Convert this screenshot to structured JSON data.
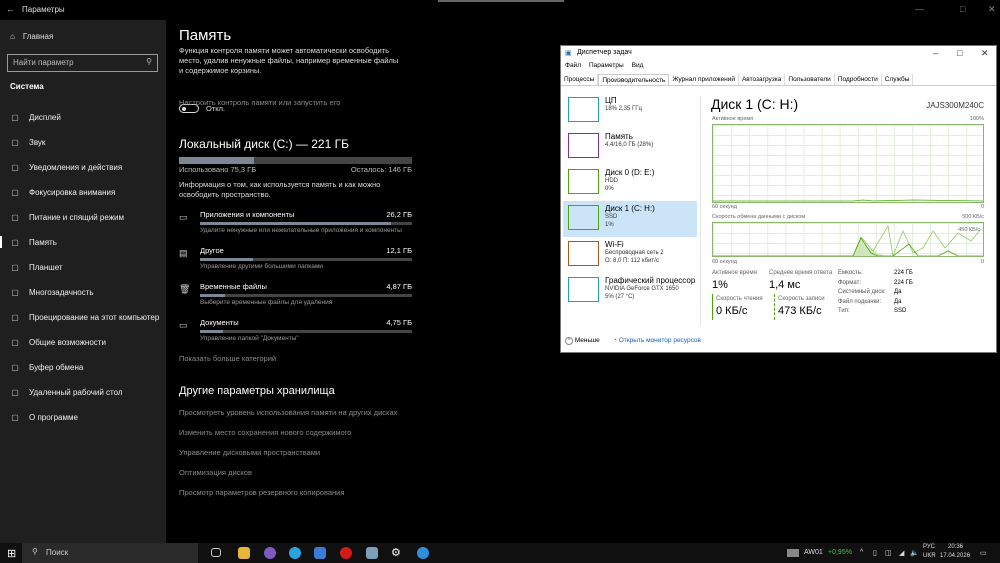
{
  "settings": {
    "title": "Параметры",
    "home": "Главная",
    "search_placeholder": "Найти параметр",
    "section": "Система",
    "nav": [
      {
        "label": "Дисплей",
        "icon": "monitor-icon"
      },
      {
        "label": "Звук",
        "icon": "speaker-icon"
      },
      {
        "label": "Уведомления и действия",
        "icon": "notification-icon"
      },
      {
        "label": "Фокусировка внимания",
        "icon": "moon-icon"
      },
      {
        "label": "Питание и спящий режим",
        "icon": "power-icon"
      },
      {
        "label": "Память",
        "icon": "storage-icon"
      },
      {
        "label": "Планшет",
        "icon": "tablet-icon"
      },
      {
        "label": "Многозадачность",
        "icon": "multitask-icon"
      },
      {
        "label": "Проецирование на этот компьютер",
        "icon": "project-icon"
      },
      {
        "label": "Общие возможности",
        "icon": "shared-icon"
      },
      {
        "label": "Буфер обмена",
        "icon": "clipboard-icon"
      },
      {
        "label": "Удаленный рабочий стол",
        "icon": "remote-icon"
      },
      {
        "label": "О программе",
        "icon": "info-icon"
      }
    ],
    "page_title": "Память",
    "intro": "Функция контроля памяти может автоматически освободить место, удалив ненужные файлы, например временные файлы и содержимое корзины.",
    "toggle_label": "Откл.",
    "configure_link": "Настроить контроль памяти или запустить его",
    "disk_title": "Локальный диск (C:) — 221 ГБ",
    "used": "Использовано 75,3 ГБ",
    "free": "Осталось: 146 ГБ",
    "used_fraction": 0.323,
    "info": "Информация о том, как используется память и как можно освободить пространство.",
    "categories": [
      {
        "name": "Приложения и компоненты",
        "size": "26,2 ГБ",
        "desc": "Удалите ненужные или нежелательные приложения и компоненты",
        "fraction": 0.9,
        "icon": "apps-icon"
      },
      {
        "name": "Другое",
        "size": "12,1 ГБ",
        "desc": "Управление другими большими папками",
        "fraction": 0.25,
        "icon": "other-icon"
      },
      {
        "name": "Временные файлы",
        "size": "4,87 ГБ",
        "desc": "Выберите временные файлы для удаления",
        "fraction": 0.12,
        "icon": "trash-icon"
      },
      {
        "name": "Документы",
        "size": "4,75 ГБ",
        "desc": "Управление папкой \"Документы\"",
        "fraction": 0.11,
        "icon": "documents-icon"
      }
    ],
    "show_more": "Показать больше категорий",
    "other_title": "Другие параметры хранилища",
    "other_links": [
      "Просмотреть уровень использования памяти на других дисках",
      "Изменить место сохранения нового содержимого",
      "Управление дисковыми пространствами",
      "Оптимизация дисков",
      "Просмотр параметров резервного копирования"
    ]
  },
  "taskmgr": {
    "title": "Диспетчер задач",
    "menu": [
      "Файл",
      "Параметры",
      "Вид"
    ],
    "tabs": [
      "Процессы",
      "Производительность",
      "Журнал приложений",
      "Автозагрузка",
      "Пользователи",
      "Подробности",
      "Службы"
    ],
    "resources": [
      {
        "name": "ЦП",
        "l1": "18% 2,35 ГГц",
        "l2": "",
        "color": "#1ca0c8"
      },
      {
        "name": "Память",
        "l1": "4,4/16,0 ГБ (28%)",
        "l2": "",
        "color": "#8b2c9c"
      },
      {
        "name": "Диск 0 (D: E:)",
        "l1": "HDD",
        "l2": "0%",
        "color": "#4da60c"
      },
      {
        "name": "Диск 1 (C: H:)",
        "l1": "SSD",
        "l2": "1%",
        "color": "#4da60c"
      },
      {
        "name": "Wi-Fi",
        "l1": "Беспроводная сеть 2",
        "l2": "О: 8,0 П: 112 кбит/с",
        "color": "#a7591c"
      },
      {
        "name": "Графический процессор",
        "l1": "NVIDIA GeForce GTX 1650",
        "l2": "5% (27 °C)",
        "color": "#1ca0c8"
      }
    ],
    "disk_title": "Диск 1 (C: H:)",
    "model": "JAJS300M240C",
    "graph1_label": "Активное время",
    "graph1_max": "100%",
    "graph1_time": "60 секунд",
    "graph1_min": "0",
    "graph2_label": "Скорость обмена данными с диском",
    "graph2_max": "500 КБ/с",
    "graph2_marker": "450 КБ/с",
    "graph2_time": "60 секунд",
    "graph2_min": "0",
    "stats": {
      "active_label": "Активное время",
      "active": "1%",
      "resp_label": "Среднее время ответа",
      "resp": "1,4 мс",
      "read_label": "Скорость чтения",
      "read": "0 КБ/с",
      "write_label": "Скорость записи",
      "write": "473 КБ/с"
    },
    "props": [
      [
        "Емкость:",
        "224 ГБ"
      ],
      [
        "Формат:",
        "224 ГБ"
      ],
      [
        "Системный диск:",
        "Да"
      ],
      [
        "Файл подкачки:",
        "Да"
      ],
      [
        "Тип:",
        "SSD"
      ]
    ],
    "fewer": "Меньше",
    "resmon": "Открыть монитор ресурсов"
  },
  "taskbar": {
    "search": "Поиск",
    "stock": "AW01",
    "stock_change": "+0,95%",
    "lang1": "РУС",
    "lang2": "UKR",
    "time": "20:36",
    "date": "17.04.2026"
  }
}
